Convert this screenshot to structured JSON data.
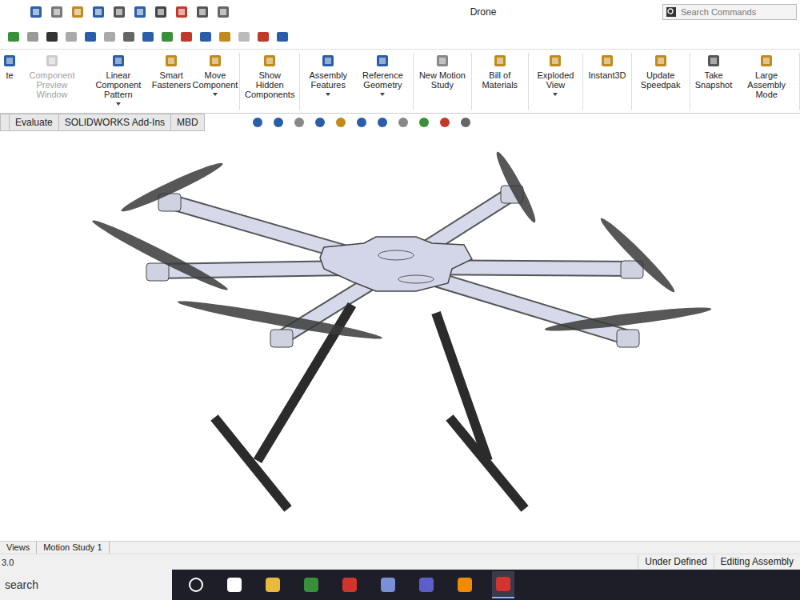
{
  "window": {
    "title": "Drone"
  },
  "search": {
    "placeholder": "Search Commands"
  },
  "ribbon": [
    [
      {
        "label": "te",
        "disabled": false,
        "dropdown": false
      },
      {
        "label": "Component Preview Window",
        "disabled": true,
        "dropdown": false
      },
      {
        "label": "Linear Component Pattern",
        "disabled": false,
        "dropdown": true
      },
      {
        "label": "Smart Fasteners",
        "disabled": false,
        "dropdown": false
      },
      {
        "label": "Move Component",
        "disabled": false,
        "dropdown": true
      }
    ],
    [
      {
        "label": "Show Hidden Components",
        "disabled": false,
        "dropdown": false
      }
    ],
    [
      {
        "label": "Assembly Features",
        "disabled": false,
        "dropdown": true
      },
      {
        "label": "Reference Geometry",
        "disabled": false,
        "dropdown": true
      }
    ],
    [
      {
        "label": "New Motion Study",
        "disabled": false,
        "dropdown": false
      }
    ],
    [
      {
        "label": "Bill of Materials",
        "disabled": false,
        "dropdown": false
      }
    ],
    [
      {
        "label": "Exploded View",
        "disabled": false,
        "dropdown": true
      }
    ],
    [
      {
        "label": "Instant3D",
        "disabled": false,
        "dropdown": false
      }
    ],
    [
      {
        "label": "Update Speedpak",
        "disabled": false,
        "dropdown": false
      }
    ],
    [
      {
        "label": "Take Snapshot",
        "disabled": false,
        "dropdown": false
      },
      {
        "label": "Large Assembly Mode",
        "disabled": false,
        "dropdown": false
      }
    ]
  ],
  "tabs": [
    {
      "label": "Evaluate",
      "selected": false
    },
    {
      "label": "SOLIDWORKS Add-Ins",
      "selected": false
    },
    {
      "label": "MBD",
      "selected": false
    }
  ],
  "bottom_tabs": [
    {
      "label": "Views",
      "selected": false
    },
    {
      "label": "Motion Study 1",
      "selected": false
    }
  ],
  "status_bar": {
    "left": "3.0",
    "items": [
      "Under Defined",
      "Editing Assembly"
    ]
  },
  "taskbar": {
    "search": "search"
  }
}
